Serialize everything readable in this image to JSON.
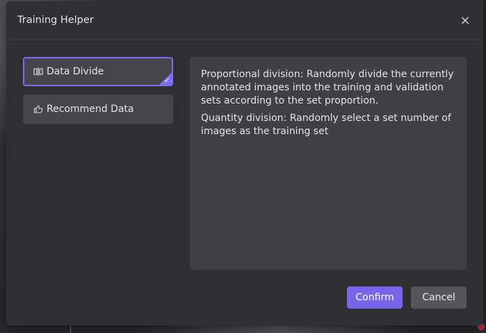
{
  "dialog": {
    "title": "Training Helper",
    "close_label": "×"
  },
  "sidebar": {
    "items": [
      {
        "label": "Data Divide",
        "icon": "split-icon",
        "active": true
      },
      {
        "label": "Recommend Data",
        "icon": "thumbs-up-icon",
        "active": false
      }
    ]
  },
  "content": {
    "paragraphs": [
      "Proportional division: Randomly divide the currently annotated images into the training and validation sets according to the set proportion.",
      "Quantity division: Randomly select a set number of images as the training set"
    ]
  },
  "footer": {
    "confirm_label": "Confirm",
    "cancel_label": "Cancel"
  },
  "colors": {
    "accent": "#7667e9",
    "dialog_bg": "#2f2f34",
    "panel_bg": "#3f3f46"
  }
}
